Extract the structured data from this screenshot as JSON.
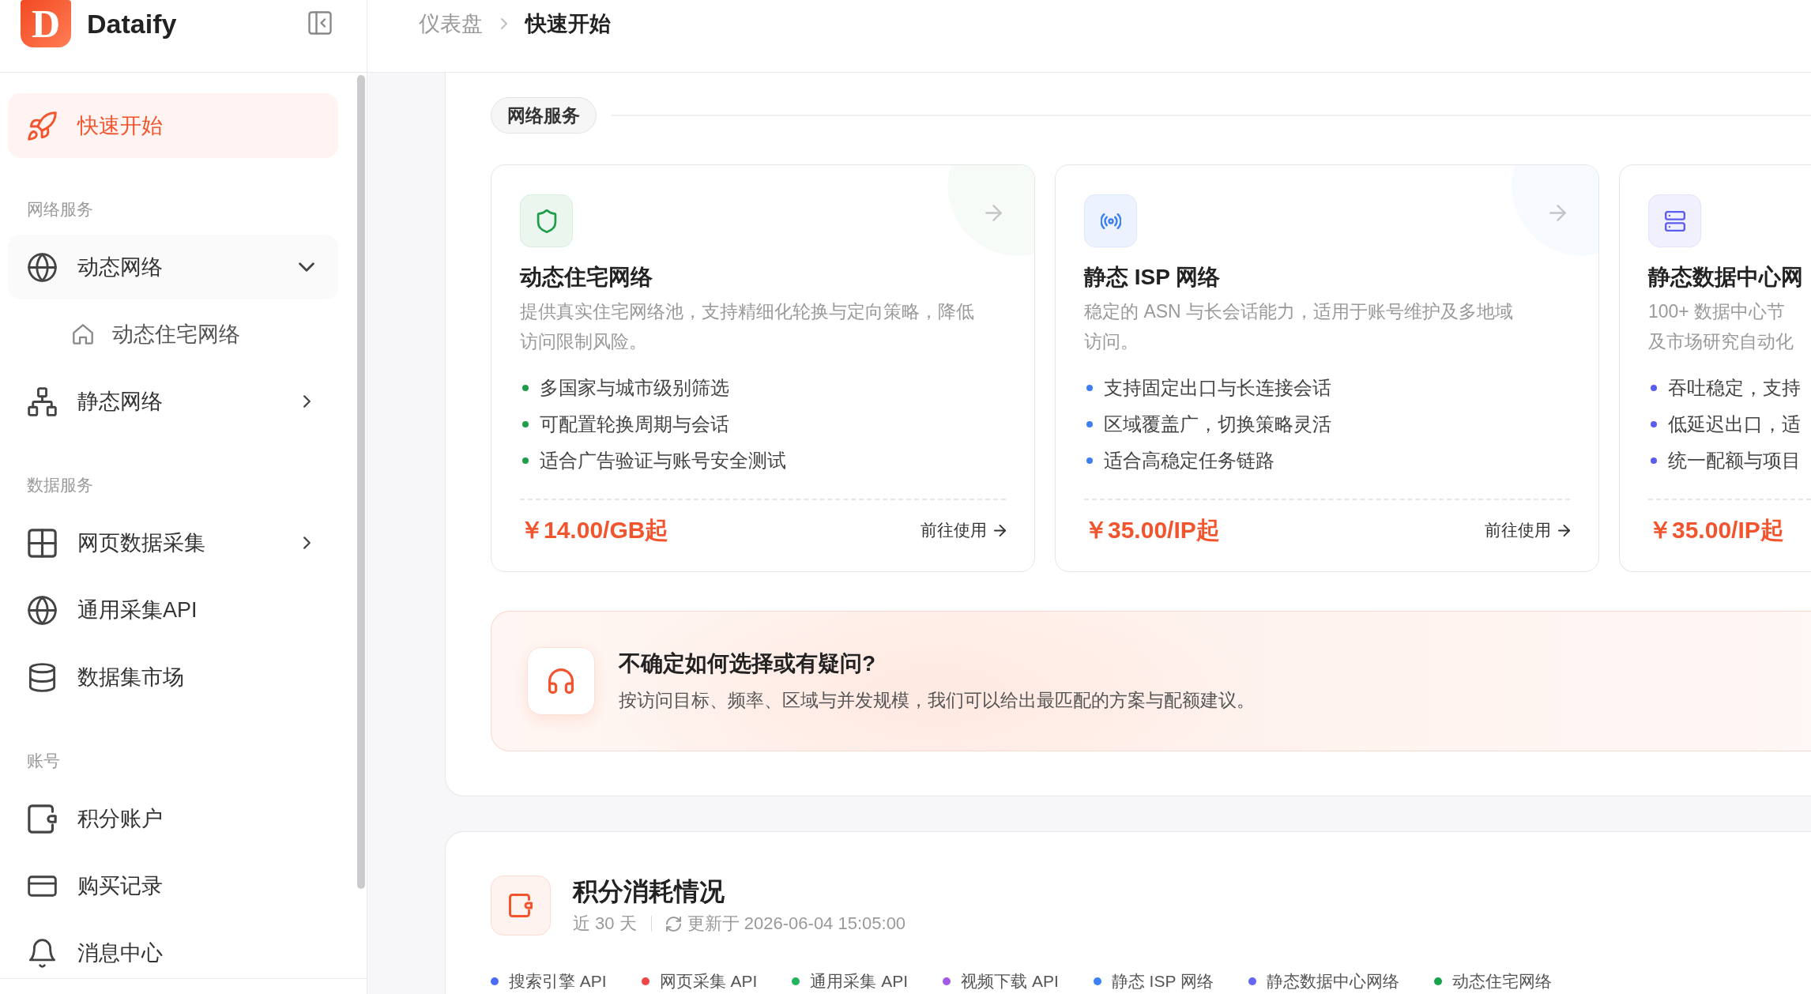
{
  "brand": {
    "logo_letter": "D",
    "name": "Dataify"
  },
  "sidebar": {
    "sections": [
      {
        "items": [
          {
            "label": "快速开始",
            "selected": true
          }
        ]
      },
      {
        "title": "网络服务",
        "items": [
          {
            "label": "动态网络",
            "selected": false,
            "expanded": true,
            "children": [
              {
                "label": "动态住宅网络",
                "selected": false
              }
            ]
          },
          {
            "label": "静态网络",
            "selected": false,
            "expanded": false
          }
        ]
      },
      {
        "title": "数据服务",
        "items": [
          {
            "label": "网页数据采集",
            "selected": false,
            "expanded": false
          },
          {
            "label": "通用采集API",
            "selected": false
          },
          {
            "label": "数据集市场",
            "selected": false
          }
        ]
      },
      {
        "title": "账号",
        "items": [
          {
            "label": "积分账户",
            "selected": false
          },
          {
            "label": "购买记录",
            "selected": false
          },
          {
            "label": "消息中心",
            "selected": false
          }
        ]
      }
    ]
  },
  "breadcrumb": [
    {
      "label": "仪表盘",
      "current": false
    },
    {
      "label": "快速开始",
      "current": true
    }
  ],
  "network_services": {
    "heading": "网络服务",
    "cards": [
      {
        "title": "动态住宅网络",
        "description": [
          "提供真实住宅网络池，支持精细化轮换与定向策略，降低",
          "访问限制风险。"
        ],
        "features": [
          "多国家与城市级别筛选",
          "可配置轮换周期与会话",
          "适合广告验证与账号安全测试"
        ],
        "price": "￥14.00/GB起",
        "link": "前往使用",
        "color": "#1f9d48"
      },
      {
        "title": "静态 ISP 网络",
        "description": [
          "稳定的 ASN 与长会话能力，适用于账号维护及多地域",
          "访问。"
        ],
        "features": [
          "支持固定出口与长连接会话",
          "区域覆盖广，切换策略灵活",
          "适合高稳定任务链路"
        ],
        "price": "￥35.00/IP起",
        "link": "前往使用",
        "color": "#3b7ff0"
      },
      {
        "title": "静态数据中心网",
        "description": [
          "100+ 数据中心节",
          "及市场研究自动化"
        ],
        "features": [
          "吞吐稳定，支持",
          "低延迟出口，适",
          "统一配额与项目"
        ],
        "price": "￥35.00/IP起",
        "color": "#5b5cf0"
      }
    ]
  },
  "help_banner": {
    "title": "不确定如何选择或有疑问?",
    "text": "按访问目标、频率、区域与并发规模，我们可以给出最匹配的方案与配额建议。"
  },
  "usage": {
    "title": "积分消耗情况",
    "period": "近 30 天",
    "updated": "更新于 2026-06-04 15:05:00",
    "legend": [
      {
        "label": "搜索引擎 API",
        "color": "#4a6cf7"
      },
      {
        "label": "网页采集 API",
        "color": "#ef4444"
      },
      {
        "label": "通用采集 API",
        "color": "#22b35e"
      },
      {
        "label": "视频下载 API",
        "color": "#a259e6"
      },
      {
        "label": "静态 ISP 网络",
        "color": "#3b82f6"
      },
      {
        "label": "静态数据中心网络",
        "color": "#6366f1"
      },
      {
        "label": "动态住宅网络",
        "color": "#16a34a"
      }
    ]
  }
}
